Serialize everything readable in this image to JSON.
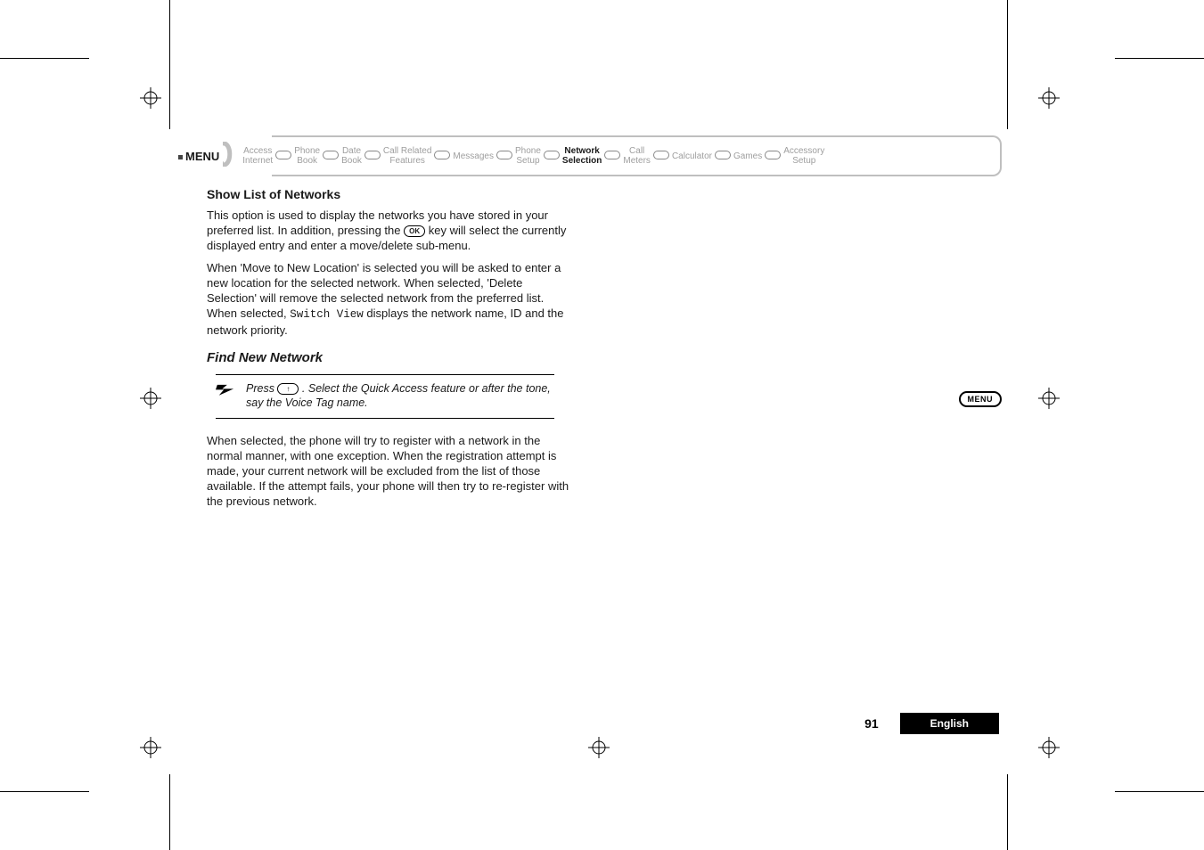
{
  "breadcrumb": {
    "menu_label": "MENU",
    "items": [
      {
        "l1": "Access",
        "l2": "Internet",
        "active": false
      },
      {
        "l1": "Phone",
        "l2": "Book",
        "active": false
      },
      {
        "l1": "Date",
        "l2": "Book",
        "active": false
      },
      {
        "l1": "Call Related",
        "l2": "Features",
        "active": false
      },
      {
        "l1": "Messages",
        "l2": "",
        "active": false
      },
      {
        "l1": "Phone",
        "l2": "Setup",
        "active": false
      },
      {
        "l1": "Network",
        "l2": "Selection",
        "active": true
      },
      {
        "l1": "Call",
        "l2": "Meters",
        "active": false
      },
      {
        "l1": "Calculator",
        "l2": "",
        "active": false
      },
      {
        "l1": "Games",
        "l2": "",
        "active": false
      },
      {
        "l1": "Accessory",
        "l2": "Setup",
        "active": false
      }
    ]
  },
  "section1": {
    "heading": "Show List of Networks",
    "p1a": "This option is used to display the networks you have stored in your preferred list. In addition, pressing the ",
    "ok_key": "OK",
    "p1b": " key will select the currently displayed entry and enter a move/delete sub-menu.",
    "p2a": "When 'Move to New Location' is selected you will be asked to enter a new location for the selected network. When selected, 'Delete Selection' will remove the selected network from the preferred list. When selected, ",
    "switch_view": "Switch View",
    "p2b": " displays the network name, ID and the network priority."
  },
  "section2": {
    "heading": "Find New Network",
    "tip_a": "Press ",
    "tip_key": "↑",
    "tip_b": ". Select the Quick Access feature or after the tone, say the Voice Tag name.",
    "p1": "When selected, the phone will try to register with a network in the normal manner, with one exception. When the registration attempt is made, your current network will be excluded from the list of those available. If the attempt fails, your phone will then try to re-register with the previous network."
  },
  "side_badge": "MENU",
  "footer": {
    "page": "91",
    "language": "English"
  }
}
